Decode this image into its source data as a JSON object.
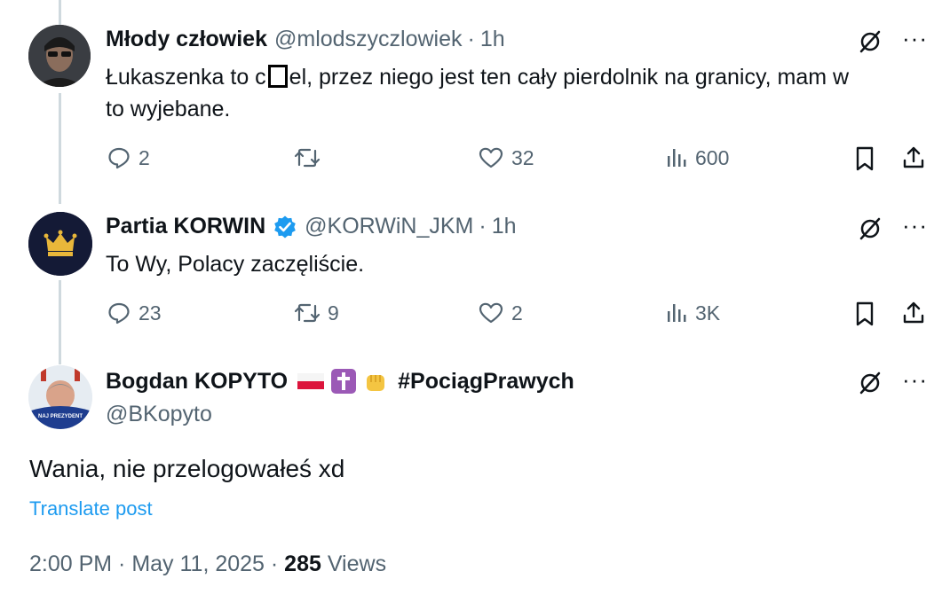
{
  "tweets": [
    {
      "name": "Młody człowiek",
      "handle": "@mlodszyczlowiek",
      "time": "1h",
      "text_before_censor": "Łukaszenka to c",
      "text_after_censor": "el, przez niego jest ten cały pierdolnik na granicy, mam w",
      "text_line2": "to wyjebane.",
      "replies": "2",
      "reposts": "",
      "likes": "32",
      "views": "600"
    },
    {
      "name": "Partia KORWIN",
      "handle": "@KORWiN_JKM",
      "time": "1h",
      "text": "To Wy, Polacy zaczęliście.",
      "replies": "23",
      "reposts": "9",
      "likes": "2",
      "views": "3K"
    }
  ],
  "main_post": {
    "name": "Bogdan KOPYTO",
    "hashtag": "#PociągPrawych",
    "handle": "@BKopyto",
    "avatar_banner": "NAJ PREZYDENT",
    "text": "Wania, nie przelogowałeś xd",
    "translate": "Translate post",
    "timestamp": "2:00 PM · May 11, 2025 · ",
    "views_count": "285",
    "views_label": " Views"
  },
  "icons": {
    "reply": "reply-icon",
    "repost": "repost-icon",
    "like": "heart-icon",
    "views": "views-icon",
    "bookmark": "bookmark-icon",
    "share": "share-icon",
    "grok": "grok-icon",
    "more": "more-icon",
    "verified": "verified-badge-icon",
    "emojis": [
      "poland-flag-icon",
      "latin-cross-icon",
      "raised-fist-icon"
    ]
  },
  "colors": {
    "text": "#0f1419",
    "secondary": "#536471",
    "link": "#1d9bf0",
    "verified": "#1d9bf0",
    "thread_line": "#cfd9de"
  },
  "sep": "·",
  "more_glyph": "···"
}
